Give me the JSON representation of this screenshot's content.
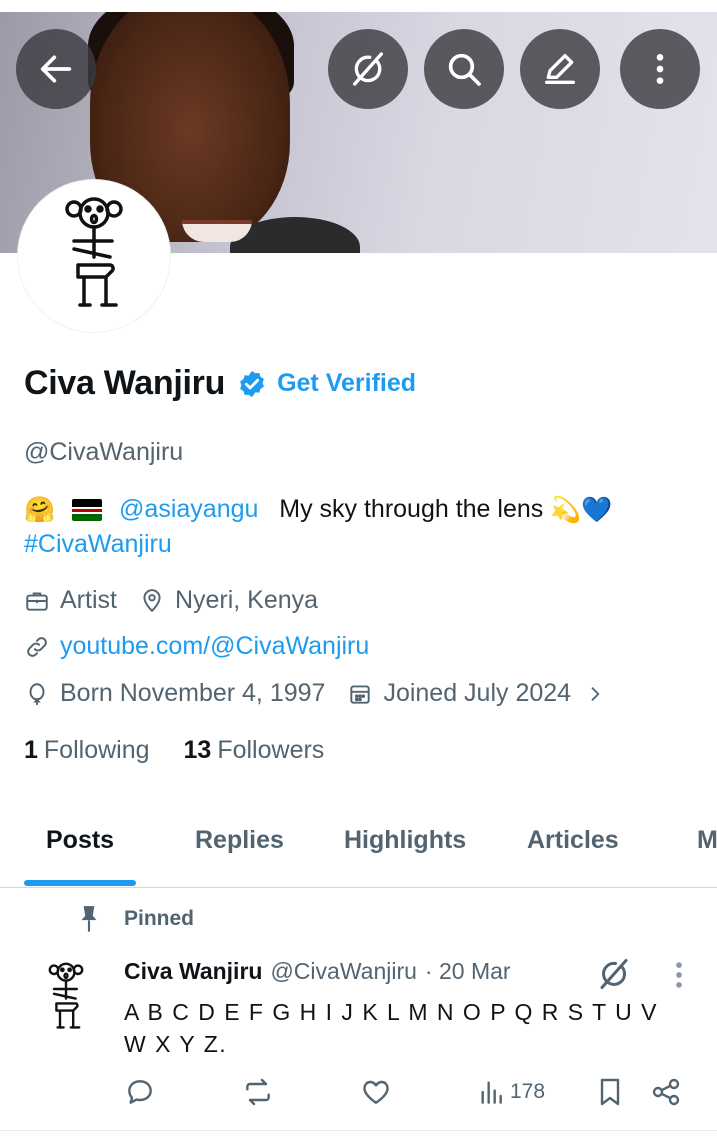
{
  "header": {
    "back_icon": "arrow-left-icon",
    "grok_icon": "grok-icon",
    "search_icon": "search-icon",
    "edit_icon": "pen-icon",
    "more_icon": "more-vertical-icon"
  },
  "profile": {
    "name": "Civa Wanjiru",
    "verified_badge_icon": "verified-badge-icon",
    "get_verified": "Get Verified",
    "handle": "@CivaWanjiru",
    "bio": {
      "emoji_hug": "🤗",
      "flag": "kenya-flag",
      "mention": "@asiayangu",
      "text": "My sky through the lens",
      "emoji_dizzy": "💫",
      "emoji_heart": "💙",
      "hashtag": "#CivaWanjiru"
    },
    "profession": "Artist",
    "location": "Nyeri, Kenya",
    "website": "youtube.com/@CivaWanjiru",
    "birth": "Born November 4, 1997",
    "joined": "Joined July 2024",
    "following_count": "1",
    "following_label": "Following",
    "followers_count": "13",
    "followers_label": "Followers"
  },
  "tabs": [
    {
      "label": "Posts",
      "active": true
    },
    {
      "label": "Replies",
      "active": false
    },
    {
      "label": "Highlights",
      "active": false
    },
    {
      "label": "Articles",
      "active": false
    },
    {
      "label": "M",
      "active": false
    }
  ],
  "pinned_post": {
    "pinned_label": "Pinned",
    "author_name": "Civa Wanjiru",
    "author_handle": "@CivaWanjiru",
    "date": "· 20 Mar",
    "text": "A B C D E F G H I J K L M N O P Q R S T U V W X Y Z.",
    "views": "178"
  },
  "colors": {
    "accent": "#1d9bf0",
    "text_primary": "#0f1419",
    "text_secondary": "#536471"
  }
}
